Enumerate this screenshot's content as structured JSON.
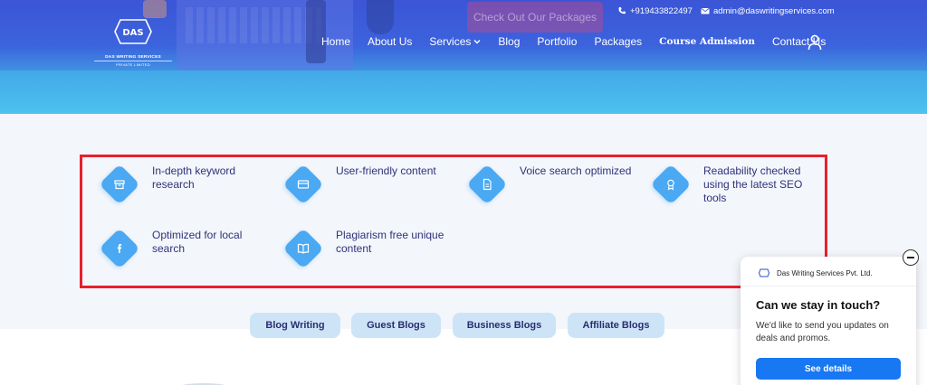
{
  "header": {
    "logo_text_line1": "DAS WRITING SERVICES",
    "logo_text_line2": "PRIVATE LIMITED",
    "cta_label": "Check Out Our Packages",
    "phone": "+919433822497",
    "email": "admin@daswritingservices.com",
    "nav": [
      {
        "label": "Home"
      },
      {
        "label": "About Us"
      },
      {
        "label": "Services"
      },
      {
        "label": "Blog"
      },
      {
        "label": "Portfolio"
      },
      {
        "label": "Packages"
      },
      {
        "label": "Course Admission"
      },
      {
        "label": "Contact Us"
      }
    ]
  },
  "features": [
    {
      "label": "In-depth keyword research",
      "icon": "archive-icon"
    },
    {
      "label": "User-friendly content",
      "icon": "card-icon"
    },
    {
      "label": "Voice search optimized",
      "icon": "document-icon"
    },
    {
      "label": "Readability checked using the latest SEO tools",
      "icon": "award-icon"
    },
    {
      "label": "Optimized for local search",
      "icon": "facebook-icon"
    },
    {
      "label": "Plagiarism free unique content",
      "icon": "book-icon"
    }
  ],
  "tabs": [
    {
      "label": "Blog Writing"
    },
    {
      "label": "Guest Blogs"
    },
    {
      "label": "Business Blogs"
    },
    {
      "label": "Affiliate Blogs"
    }
  ],
  "popup": {
    "brand": "Das Writing Services Pvt. Ltd.",
    "title": "Can we stay in touch?",
    "body": "We'd like to send you updates on deals and promos.",
    "button": "See details"
  },
  "colors": {
    "header_blue": "#3b55d6",
    "accent_blue": "#4aa9f2",
    "highlight_red": "#e8202b",
    "tab_bg": "#cde4f7",
    "button_blue": "#1877f2"
  }
}
